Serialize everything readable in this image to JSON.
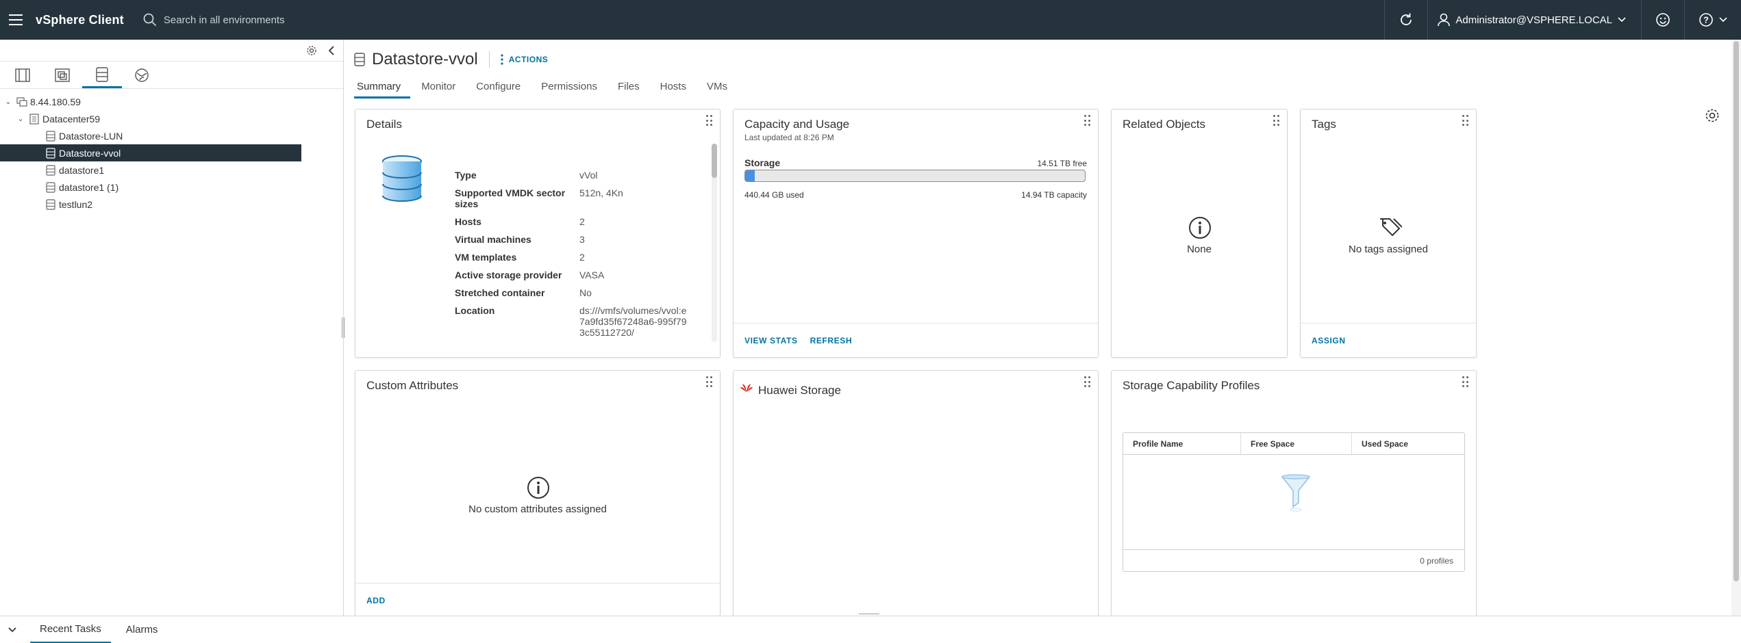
{
  "header": {
    "brand": "vSphere Client",
    "search_placeholder": "Search in all environments",
    "user": "Administrator@VSPHERE.LOCAL"
  },
  "tree": [
    {
      "label": "8.44.180.59",
      "level": 0,
      "icon": "vcenter-icon"
    },
    {
      "label": "Datacenter59",
      "level": 1,
      "icon": "datacenter-icon"
    },
    {
      "label": "Datastore-LUN",
      "level": 2,
      "icon": "datastore-icon"
    },
    {
      "label": "Datastore-vvol",
      "level": 2,
      "icon": "datastore-icon",
      "selected": true
    },
    {
      "label": "datastore1",
      "level": 2,
      "icon": "datastore-icon"
    },
    {
      "label": "datastore1 (1)",
      "level": 2,
      "icon": "datastore-icon"
    },
    {
      "label": "testlun2",
      "level": 2,
      "icon": "datastore-icon"
    }
  ],
  "object": {
    "title": "Datastore-vvol",
    "actions_label": "ACTIONS"
  },
  "tabs": [
    "Summary",
    "Monitor",
    "Configure",
    "Permissions",
    "Files",
    "Hosts",
    "VMs"
  ],
  "details": {
    "title": "Details",
    "rows": [
      {
        "label": "Type",
        "value": "vVol"
      },
      {
        "label": "Supported VMDK sector sizes",
        "value": "512n, 4Kn"
      },
      {
        "label": "Hosts",
        "value": "2"
      },
      {
        "label": "Virtual machines",
        "value": "3"
      },
      {
        "label": "VM templates",
        "value": "2"
      },
      {
        "label": "Active storage provider",
        "value": "VASA"
      },
      {
        "label": "Stretched container",
        "value": "No"
      },
      {
        "label": "Location",
        "value": "ds:///vmfs/volumes/vvol:e7a9fd35f67248a6-995f793c55112720/"
      }
    ]
  },
  "capacity": {
    "title": "Capacity and Usage",
    "updated": "Last updated at 8:26 PM",
    "storage_label": "Storage",
    "free": "14.51 TB free",
    "used": "440.44 GB used",
    "capacity": "14.94 TB capacity",
    "used_fraction": 0.0288,
    "view_stats": "VIEW STATS",
    "refresh": "REFRESH"
  },
  "related": {
    "title": "Related Objects",
    "message": "None"
  },
  "tags": {
    "title": "Tags",
    "message": "No tags assigned",
    "assign": "ASSIGN"
  },
  "custom_attributes": {
    "title": "Custom Attributes",
    "message": "No custom attributes assigned",
    "add": "ADD"
  },
  "huawei": {
    "title": "Huawei Storage",
    "logo_color": "#e1251b"
  },
  "profiles": {
    "title": "Storage Capability Profiles",
    "columns": [
      "Profile Name",
      "Free Space",
      "Used Space"
    ],
    "footer": "0 profiles"
  },
  "bottom": {
    "tabs": [
      "Recent Tasks",
      "Alarms"
    ]
  },
  "colors": {
    "header_bg": "#25333d",
    "accent": "#0072a3",
    "bar_fill": "#4a90e2"
  }
}
